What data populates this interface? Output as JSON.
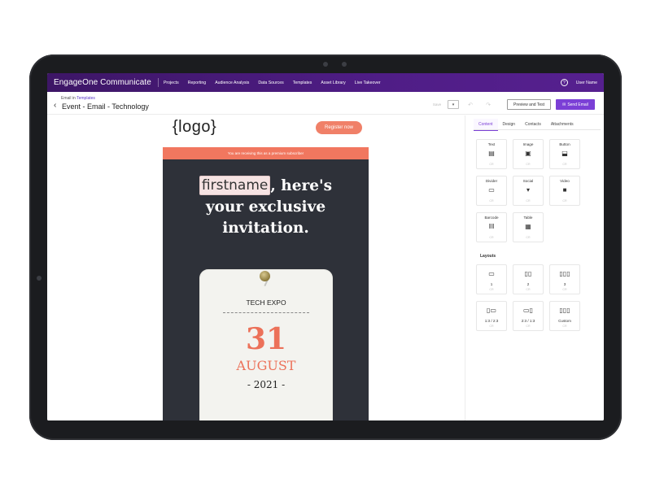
{
  "nav": {
    "brand": "EngageOne Communicate",
    "links": [
      "Projects",
      "Reporting",
      "Audience Analysis",
      "Data Sources",
      "Templates",
      "Asset Library",
      "Live Takeover"
    ],
    "help_glyph": "?",
    "user": "User Name"
  },
  "header": {
    "crumb_prefix": "Email in",
    "crumb_link": "Templates",
    "back_glyph": "‹",
    "title": "Event - Email - Technology",
    "save_label": "Save",
    "dropdown_glyph": "▾",
    "undo_glyph": "↶",
    "redo_glyph": "↷",
    "preview_label": "Preview and Test",
    "send_label": "Send Email",
    "send_icon": "✉"
  },
  "email": {
    "logo": "{logo}",
    "register_label": "Register now",
    "banner_text": "You are receiving this as a premium subscriber",
    "firstname_token": "firstname",
    "headline_rest_1": ", here's",
    "headline_line2": "your exclusive",
    "headline_line3": "invitation.",
    "card_title": "TECH EXPO",
    "card_day": "31",
    "card_month": "AUGUST",
    "card_year": "- 2021 -"
  },
  "panel": {
    "tabs": [
      "Content",
      "Design",
      "Contacts",
      "Attachments"
    ],
    "content_tiles": [
      {
        "label": "Text",
        "icon": "text-icon",
        "glyph": "▤",
        "sub": "CR"
      },
      {
        "label": "Image",
        "icon": "image-icon",
        "glyph": "▣",
        "sub": "CR"
      },
      {
        "label": "Button",
        "icon": "button-icon",
        "glyph": "⬓",
        "sub": "CR"
      },
      {
        "label": "Divider",
        "icon": "divider-icon",
        "glyph": "▭",
        "sub": "CR"
      },
      {
        "label": "Social",
        "icon": "social-icon",
        "glyph": "▾",
        "sub": "CR"
      },
      {
        "label": "Video",
        "icon": "video-icon",
        "glyph": "■",
        "sub": "CR"
      },
      {
        "label": "Barcode",
        "icon": "barcode-icon",
        "glyph": "‖‖",
        "sub": "CR"
      },
      {
        "label": "Table",
        "icon": "table-icon",
        "glyph": "▦",
        "sub": "CR"
      }
    ],
    "layouts_heading": "Layouts",
    "layout_tiles": [
      {
        "label": "1",
        "icon": "layout-1-icon",
        "glyph": "▭",
        "sub": "CR"
      },
      {
        "label": "2",
        "icon": "layout-2-icon",
        "glyph": "▯▯",
        "sub": "CR"
      },
      {
        "label": "3",
        "icon": "layout-3-icon",
        "glyph": "▯▯▯",
        "sub": "CR"
      },
      {
        "label": "1:3 / 2:3",
        "icon": "layout-1-3-icon",
        "glyph": "▯▭",
        "sub": "CR"
      },
      {
        "label": "2:3 / 1:3",
        "icon": "layout-2-3-icon",
        "glyph": "▭▯",
        "sub": "CR"
      },
      {
        "label": "Custom",
        "icon": "layout-custom-icon",
        "glyph": "▯▯▯",
        "sub": "CR"
      }
    ]
  },
  "colors": {
    "nav": "#4f1d86",
    "accent": "#7b3fd6",
    "coral": "#f1775f",
    "hero_bg": "#2e3139"
  }
}
